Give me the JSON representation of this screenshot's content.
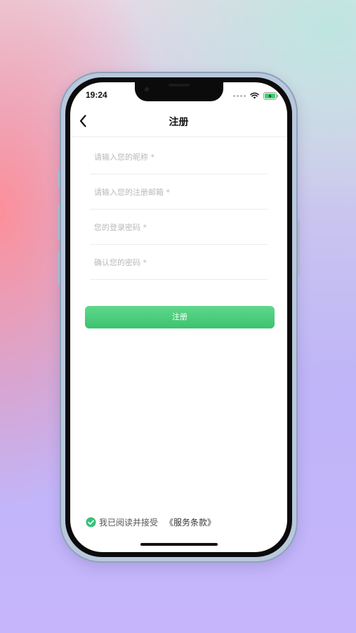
{
  "status_bar": {
    "time": "19:24"
  },
  "nav": {
    "title": "注册"
  },
  "form": {
    "nickname_placeholder": "请输入您的昵称 *",
    "email_placeholder": "请输入您的注册邮箱 *",
    "password_placeholder": "您的登录密码 *",
    "confirm_placeholder": "确认您的密码 *",
    "submit_label": "注册"
  },
  "agreement": {
    "text": "我已阅读并接受",
    "link": "《服务条款》",
    "checked": true
  },
  "colors": {
    "accent_green": "#3cc26f",
    "check_green": "#34c27a"
  },
  "icons": [
    "back-icon",
    "wifi-icon",
    "battery-icon",
    "cellular-signal-icon",
    "check-circle-icon"
  ]
}
